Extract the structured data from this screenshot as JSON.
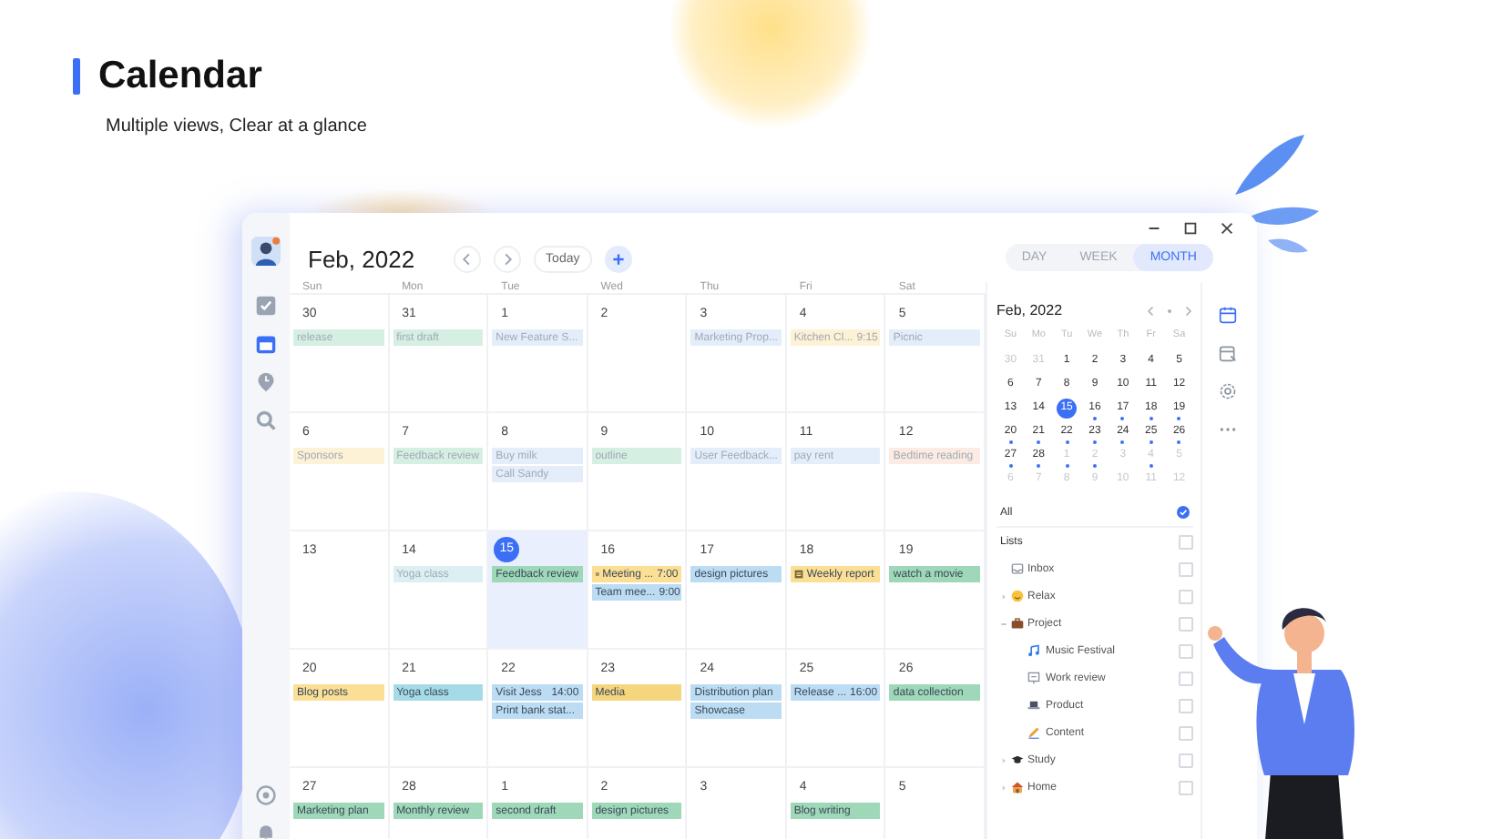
{
  "hero": {
    "title": "Calendar",
    "subtitle": "Multiple views, Clear at a glance"
  },
  "app": {
    "sidebar": {
      "top": [
        {
          "kind": "tasks",
          "selected": false
        },
        {
          "kind": "calendar",
          "selected": true
        },
        {
          "kind": "pin",
          "selected": false
        },
        {
          "kind": "search",
          "selected": false
        }
      ],
      "bottom": [
        {
          "kind": "settings",
          "selected": false
        },
        {
          "kind": "bell",
          "selected": false
        }
      ]
    },
    "header": {
      "month": "Feb, 2022",
      "today_button": "Today"
    },
    "view_tabs": [
      {
        "label": "DAY",
        "selected": false
      },
      {
        "label": "WEEK",
        "selected": false
      },
      {
        "label": "MONTH",
        "selected": true
      }
    ],
    "weekdays": [
      "Sun",
      "Mon",
      "Tue",
      "Wed",
      "Thu",
      "Fri",
      "Sat"
    ],
    "weeks": [
      [
        {
          "day": "30",
          "today": false,
          "events": [
            {
              "text": "release",
              "color": "#d6efe3",
              "done": true
            }
          ]
        },
        {
          "day": "31",
          "today": false,
          "events": [
            {
              "text": "first draft",
              "color": "#d6efe3",
              "done": true
            }
          ]
        },
        {
          "day": "1",
          "today": false,
          "events": [
            {
              "text": "New Feature S...",
              "color": "#e4eefa",
              "done": true
            }
          ]
        },
        {
          "day": "2",
          "today": false
        },
        {
          "day": "3",
          "today": false,
          "events": [
            {
              "text": "Marketing Prop...",
              "color": "#e4eefa",
              "done": true
            }
          ]
        },
        {
          "day": "4",
          "today": false,
          "events": [
            {
              "text": "Kitchen Cl...",
              "time": "9:15",
              "color": "#fdf1d6",
              "done": true
            }
          ]
        },
        {
          "day": "5",
          "today": false,
          "events": [
            {
              "text": "Picnic",
              "color": "#e4eefa",
              "done": true
            }
          ]
        }
      ],
      [
        {
          "day": "6",
          "today": false,
          "events": [
            {
              "text": "Sponsors",
              "color": "#fdf1d6",
              "done": true
            }
          ]
        },
        {
          "day": "7",
          "today": false,
          "events": [
            {
              "text": "Feedback review",
              "color": "#d6efe3",
              "done": true
            }
          ]
        },
        {
          "day": "8",
          "today": false,
          "events": [
            {
              "text": "Buy milk",
              "color": "#e4eefa",
              "done": true
            },
            {
              "text": "Call Sandy",
              "color": "#e4eefa",
              "done": true
            }
          ]
        },
        {
          "day": "9",
          "today": false,
          "events": [
            {
              "text": "outline",
              "color": "#d6efe3",
              "done": true
            }
          ]
        },
        {
          "day": "10",
          "today": false,
          "events": [
            {
              "text": "User Feedback...",
              "color": "#e4eefa",
              "done": true
            }
          ]
        },
        {
          "day": "11",
          "today": false,
          "events": [
            {
              "text": "pay rent",
              "color": "#e4eefa",
              "done": true
            }
          ]
        },
        {
          "day": "12",
          "today": false,
          "events": [
            {
              "text": "Bedtime reading",
              "color": "#fcebe2",
              "done": true
            }
          ]
        }
      ],
      [
        {
          "day": "13",
          "today": false
        },
        {
          "day": "14",
          "today": false,
          "events": [
            {
              "text": "Yoga class",
              "color": "#dcf0f4",
              "done": true
            }
          ]
        },
        {
          "day": "15",
          "today": true,
          "events": [
            {
              "text": "Feedback review",
              "color": "#9fd8b8",
              "done": false
            }
          ]
        },
        {
          "day": "16",
          "today": false,
          "events": [
            {
              "text": "Meeting ...",
              "time": "7:00",
              "color": "#fbdf95",
              "done": false,
              "flag": true
            },
            {
              "text": "Team mee...",
              "time": "9:00",
              "color": "#bcdcf3",
              "done": false
            }
          ]
        },
        {
          "day": "17",
          "today": false,
          "events": [
            {
              "text": "design pictures",
              "color": "#bcdcf3",
              "done": false
            }
          ]
        },
        {
          "day": "18",
          "today": false,
          "events": [
            {
              "text": "Weekly report",
              "color": "#fbdf95",
              "done": false,
              "flag": true
            }
          ]
        },
        {
          "day": "19",
          "today": false,
          "events": [
            {
              "text": "watch a movie",
              "color": "#9fd8b8",
              "done": false
            }
          ]
        }
      ],
      [
        {
          "day": "20",
          "today": false,
          "events": [
            {
              "text": "Blog posts",
              "color": "#fbdf95",
              "done": false
            }
          ]
        },
        {
          "day": "21",
          "today": false,
          "events": [
            {
              "text": "Yoga class",
              "color": "#a5dbe6",
              "done": false
            }
          ]
        },
        {
          "day": "22",
          "today": false,
          "events": [
            {
              "text": "Visit Jess",
              "time": "14:00",
              "color": "#bcdcf3",
              "done": false
            },
            {
              "text": "Print bank stat...",
              "color": "#bcdcf3",
              "done": false
            }
          ]
        },
        {
          "day": "23",
          "today": false,
          "events": [
            {
              "text": "Media",
              "color": "#f6d57f",
              "done": false
            }
          ]
        },
        {
          "day": "24",
          "today": false,
          "events": [
            {
              "text": "Distribution plan",
              "color": "#bcdcf3",
              "done": false
            },
            {
              "text": "Showcase",
              "color": "#bcdcf3",
              "done": false
            }
          ]
        },
        {
          "day": "25",
          "today": false,
          "events": [
            {
              "text": "Release ...",
              "time": "16:00",
              "color": "#bcdcf3",
              "done": false
            }
          ]
        },
        {
          "day": "26",
          "today": false,
          "events": [
            {
              "text": "data collection",
              "color": "#9fd8b8",
              "done": false
            }
          ]
        }
      ],
      [
        {
          "day": "27",
          "today": false,
          "events": [
            {
              "text": "Marketing plan",
              "color": "#9fd8b8",
              "done": false
            }
          ]
        },
        {
          "day": "28",
          "today": false,
          "events": [
            {
              "text": "Monthly review",
              "color": "#9fd8b8",
              "done": false
            }
          ]
        },
        {
          "day": "1",
          "today": false,
          "events": [
            {
              "text": "second draft",
              "color": "#9fd8b8",
              "done": false
            }
          ]
        },
        {
          "day": "2",
          "today": false,
          "events": [
            {
              "text": "design pictures",
              "color": "#9fd8b8",
              "done": false
            }
          ]
        },
        {
          "day": "3",
          "today": false
        },
        {
          "day": "4",
          "today": false,
          "events": [
            {
              "text": "Blog writing",
              "color": "#9fd8b8",
              "done": false
            }
          ]
        },
        {
          "day": "5",
          "today": false
        }
      ]
    ],
    "mini_calendar": {
      "title": "Feb, 2022",
      "weekdays": [
        "Su",
        "Mo",
        "Tu",
        "We",
        "Th",
        "Fr",
        "Sa"
      ],
      "days": [
        {
          "d": "30",
          "muted": true,
          "selected": false,
          "dot": false
        },
        {
          "d": "31",
          "muted": true,
          "selected": false,
          "dot": false
        },
        {
          "d": "1",
          "muted": false,
          "selected": false,
          "dot": false
        },
        {
          "d": "2",
          "muted": false,
          "selected": false,
          "dot": false
        },
        {
          "d": "3",
          "muted": false,
          "selected": false,
          "dot": false
        },
        {
          "d": "4",
          "muted": false,
          "selected": false,
          "dot": false
        },
        {
          "d": "5",
          "muted": false,
          "selected": false,
          "dot": false
        },
        {
          "d": "6",
          "muted": false,
          "selected": false,
          "dot": false
        },
        {
          "d": "7",
          "muted": false,
          "selected": false,
          "dot": false
        },
        {
          "d": "8",
          "muted": false,
          "selected": false,
          "dot": false
        },
        {
          "d": "9",
          "muted": false,
          "selected": false,
          "dot": false
        },
        {
          "d": "10",
          "muted": false,
          "selected": false,
          "dot": false
        },
        {
          "d": "11",
          "muted": false,
          "selected": false,
          "dot": false
        },
        {
          "d": "12",
          "muted": false,
          "selected": false,
          "dot": false
        },
        {
          "d": "13",
          "muted": false,
          "selected": false,
          "dot": false
        },
        {
          "d": "14",
          "muted": false,
          "selected": false,
          "dot": false
        },
        {
          "d": "15",
          "muted": false,
          "selected": true,
          "dot": false
        },
        {
          "d": "16",
          "muted": false,
          "selected": false,
          "dot": true
        },
        {
          "d": "17",
          "muted": false,
          "selected": false,
          "dot": true
        },
        {
          "d": "18",
          "muted": false,
          "selected": false,
          "dot": true
        },
        {
          "d": "19",
          "muted": false,
          "selected": false,
          "dot": true
        },
        {
          "d": "20",
          "muted": false,
          "selected": false,
          "dot": true
        },
        {
          "d": "21",
          "muted": false,
          "selected": false,
          "dot": true
        },
        {
          "d": "22",
          "muted": false,
          "selected": false,
          "dot": true
        },
        {
          "d": "23",
          "muted": false,
          "selected": false,
          "dot": true
        },
        {
          "d": "24",
          "muted": false,
          "selected": false,
          "dot": true
        },
        {
          "d": "25",
          "muted": false,
          "selected": false,
          "dot": true
        },
        {
          "d": "26",
          "muted": false,
          "selected": false,
          "dot": true
        },
        {
          "d": "27",
          "muted": false,
          "selected": false,
          "dot": true
        },
        {
          "d": "28",
          "muted": false,
          "selected": false,
          "dot": true
        },
        {
          "d": "1",
          "muted": true,
          "selected": false,
          "dot": true
        },
        {
          "d": "2",
          "muted": true,
          "selected": false,
          "dot": true
        },
        {
          "d": "3",
          "muted": true,
          "selected": false,
          "dot": false
        },
        {
          "d": "4",
          "muted": true,
          "selected": false,
          "dot": true
        },
        {
          "d": "5",
          "muted": true,
          "selected": false,
          "dot": false
        },
        {
          "d": "6",
          "muted": true,
          "selected": false,
          "dot": false
        },
        {
          "d": "7",
          "muted": true,
          "selected": false,
          "dot": false
        },
        {
          "d": "8",
          "muted": true,
          "selected": false,
          "dot": false
        },
        {
          "d": "9",
          "muted": true,
          "selected": false,
          "dot": false
        },
        {
          "d": "10",
          "muted": true,
          "selected": false,
          "dot": false
        },
        {
          "d": "11",
          "muted": true,
          "selected": false,
          "dot": false
        },
        {
          "d": "12",
          "muted": true,
          "selected": false,
          "dot": false
        }
      ],
      "all_label": "All",
      "all_checked": true
    },
    "lists": {
      "title": "Lists",
      "checked": false,
      "items": [
        {
          "name": "Inbox",
          "kind": "inbox",
          "checked": false
        },
        {
          "name": "Relax",
          "kind": "smile",
          "checked": false,
          "expanded": false
        },
        {
          "name": "Project",
          "kind": "briefcase",
          "checked": false,
          "expanded": true,
          "children": [
            {
              "name": "Music Festival",
              "kind": "music",
              "checked": false
            },
            {
              "name": "Work review",
              "kind": "board",
              "checked": false
            },
            {
              "name": "Product",
              "kind": "laptop",
              "checked": false
            },
            {
              "name": "Content",
              "kind": "pen",
              "checked": false
            }
          ]
        },
        {
          "name": "Study",
          "kind": "cap",
          "checked": false,
          "expanded": false
        },
        {
          "name": "Home",
          "kind": "house",
          "checked": false,
          "expanded": false
        }
      ]
    }
  }
}
